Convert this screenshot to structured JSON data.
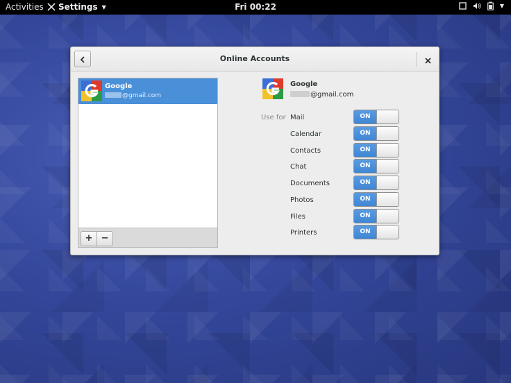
{
  "topbar": {
    "activities": "Activities",
    "app_menu": "Settings",
    "clock": "Fri 00:22"
  },
  "dialog": {
    "title": "Online Accounts"
  },
  "accounts_list": [
    {
      "name": "Google",
      "email_suffix": "@gmail.com"
    }
  ],
  "list_toolbar": {
    "add_label": "+",
    "remove_label": "−"
  },
  "account_detail": {
    "name": "Google",
    "email_suffix": "@gmail.com",
    "use_for_label": "Use for",
    "services": [
      {
        "label": "Mail",
        "state": "ON"
      },
      {
        "label": "Calendar",
        "state": "ON"
      },
      {
        "label": "Contacts",
        "state": "ON"
      },
      {
        "label": "Chat",
        "state": "ON"
      },
      {
        "label": "Documents",
        "state": "ON"
      },
      {
        "label": "Photos",
        "state": "ON"
      },
      {
        "label": "Files",
        "state": "ON"
      },
      {
        "label": "Printers",
        "state": "ON"
      }
    ]
  },
  "colors": {
    "selection": "#4a90d9",
    "switch_on": "#3f86d4",
    "desktop": "#34479b"
  }
}
